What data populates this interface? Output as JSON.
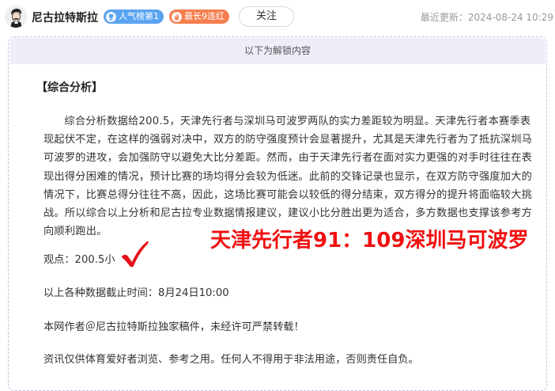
{
  "header": {
    "author": "尼古拉特斯拉",
    "badges": [
      {
        "label": "人气榜第1",
        "color": "#5aa3f0",
        "icon": "trophy-icon"
      },
      {
        "label": "最长9连红",
        "color": "#f57e4f",
        "icon": "flame-icon"
      }
    ],
    "follow_label": "关注",
    "last_updated": "最近更新：2024-08-24 10:29"
  },
  "article": {
    "unlock_notice": "以下为解锁内容",
    "section_title": "【综合分析】",
    "analysis": "综合分析数据给200.5，天津先行者与深圳马可波罗两队的实力差距较为明显。天津先行者本赛季表现起伏不定，在这样的强弱对决中，双方的防守强度预计会显著提升，尤其是天津先行者为了抵抗深圳马可波罗的进攻，会加强防守以避免大比分差距。然而，由于天津先行者在面对实力更强的对手时往往在表现出得分困难的情况，预计比赛的场均得分会较为低迷。此前的交锋记录也显示，在双方防守强度加大的情况下，比赛总得分往往不高，因此，这场比赛可能会以较低的得分结束，双方得分的提升将面临较大挑战。所以综合以上分析和尼古拉专业数据情报建议，建议小比分胜出更为适合，多方数据也支撑该参考方向顺利跑出。",
    "viewpoint": "观点：200.5小",
    "data_cutoff": "以上各种数据截止时间：8月24日10:00",
    "copyright": "本网作者＠尼古拉特斯拉独家稿件，未经许可严禁转载！",
    "disclaimer": "资讯仅供体育爱好者浏览、参考之用。任何人不得用于非法用途，否则责任自负。"
  },
  "result_overlay": {
    "text": "天津先行者91：109深圳马可波罗",
    "color": "#f01010"
  },
  "check_mark": {
    "icon": "checkmark-icon",
    "color": "#e8101a"
  }
}
